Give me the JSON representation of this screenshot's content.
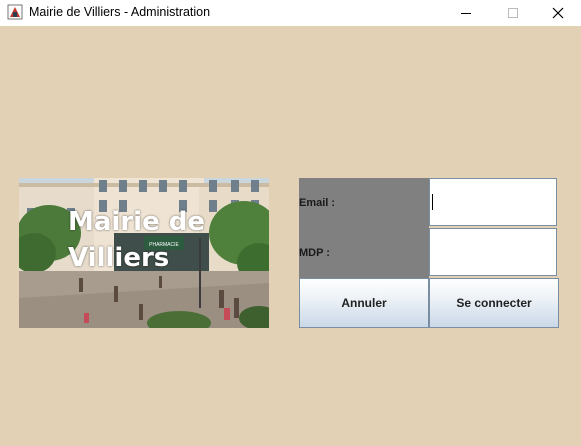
{
  "window": {
    "title": "Mairie de Villiers - Administration",
    "controls": [
      "minimize",
      "maximize",
      "close"
    ]
  },
  "hero": {
    "title": "Mairie de Villiers",
    "shop_sign": "PHARMACIE"
  },
  "login_form": {
    "email_label": "Email :",
    "email_value": "",
    "password_label": "MDP :",
    "password_value": "",
    "cancel_label": "Annuler",
    "submit_label": "Se connecter"
  },
  "colors": {
    "background": "#e2d1b5",
    "label_panel": "#808080",
    "button_border": "#7a8ea3"
  }
}
